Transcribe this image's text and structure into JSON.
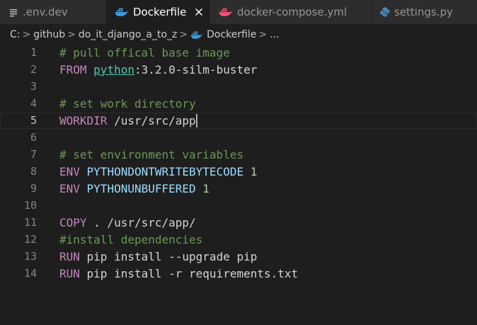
{
  "tabs": [
    {
      "label": ".env.dev",
      "icon": "lines-icon",
      "active": false
    },
    {
      "label": "Dockerfile",
      "icon": "docker-whale-icon",
      "active": true,
      "close": "×"
    },
    {
      "label": "docker-compose.yml",
      "icon": "docker-whale-icon",
      "active": false
    },
    {
      "label": "settings.py",
      "icon": "python-icon",
      "active": false
    }
  ],
  "breadcrumb": {
    "items": [
      "C:",
      "github",
      "do_it_django_a_to_z",
      "Dockerfile",
      "..."
    ],
    "separator": ">"
  },
  "editor": {
    "current_line": 5,
    "lines": [
      {
        "number": "1",
        "t": [
          {
            "c": "comment",
            "v": "# pull offical base image"
          }
        ]
      },
      {
        "number": "2",
        "t": [
          {
            "c": "keyword",
            "v": "FROM "
          },
          {
            "c": "image",
            "v": "python"
          },
          {
            "c": "plain",
            "v": ":3.2.0-silm-buster"
          }
        ]
      },
      {
        "number": "3",
        "t": []
      },
      {
        "number": "4",
        "t": [
          {
            "c": "comment",
            "v": "# set work directory"
          }
        ]
      },
      {
        "number": "5",
        "t": [
          {
            "c": "keyword",
            "v": "WORKDIR"
          },
          {
            "c": "plain",
            "v": " /usr/src/app"
          }
        ]
      },
      {
        "number": "6",
        "t": []
      },
      {
        "number": "7",
        "t": [
          {
            "c": "comment",
            "v": "# set environment variables"
          }
        ]
      },
      {
        "number": "8",
        "t": [
          {
            "c": "keyword",
            "v": "ENV"
          },
          {
            "c": "var",
            "v": " PYTHONDONTWRITEBYTECODE"
          },
          {
            "c": "number",
            "v": " 1"
          }
        ]
      },
      {
        "number": "9",
        "t": [
          {
            "c": "keyword",
            "v": "ENV"
          },
          {
            "c": "var",
            "v": " PYTHONUNBUFFERED"
          },
          {
            "c": "number",
            "v": " 1"
          }
        ]
      },
      {
        "number": "10",
        "t": []
      },
      {
        "number": "11",
        "t": [
          {
            "c": "keyword",
            "v": "COPY"
          },
          {
            "c": "plain",
            "v": " . /usr/src/app/"
          }
        ]
      },
      {
        "number": "12",
        "t": [
          {
            "c": "comment",
            "v": "#install dependencies"
          }
        ]
      },
      {
        "number": "13",
        "t": [
          {
            "c": "keyword",
            "v": "RUN"
          },
          {
            "c": "plain",
            "v": " pip install --upgrade pip"
          }
        ]
      },
      {
        "number": "14",
        "t": [
          {
            "c": "keyword",
            "v": "RUN"
          },
          {
            "c": "plain",
            "v": " pip install -r requirements.txt"
          }
        ]
      }
    ]
  },
  "colors": {
    "background": "#1e1e1e",
    "tabbar": "#252526",
    "inactive_tab": "#2d2d2d",
    "docker_blue": "#3c99dc",
    "compose_pink": "#f05279",
    "python_blue": "#4b8bbe",
    "comment": "#6a9955",
    "keyword": "#c586c0",
    "variable": "#9cdcfe",
    "number": "#b5cea8",
    "image": "#4ec9b0"
  }
}
